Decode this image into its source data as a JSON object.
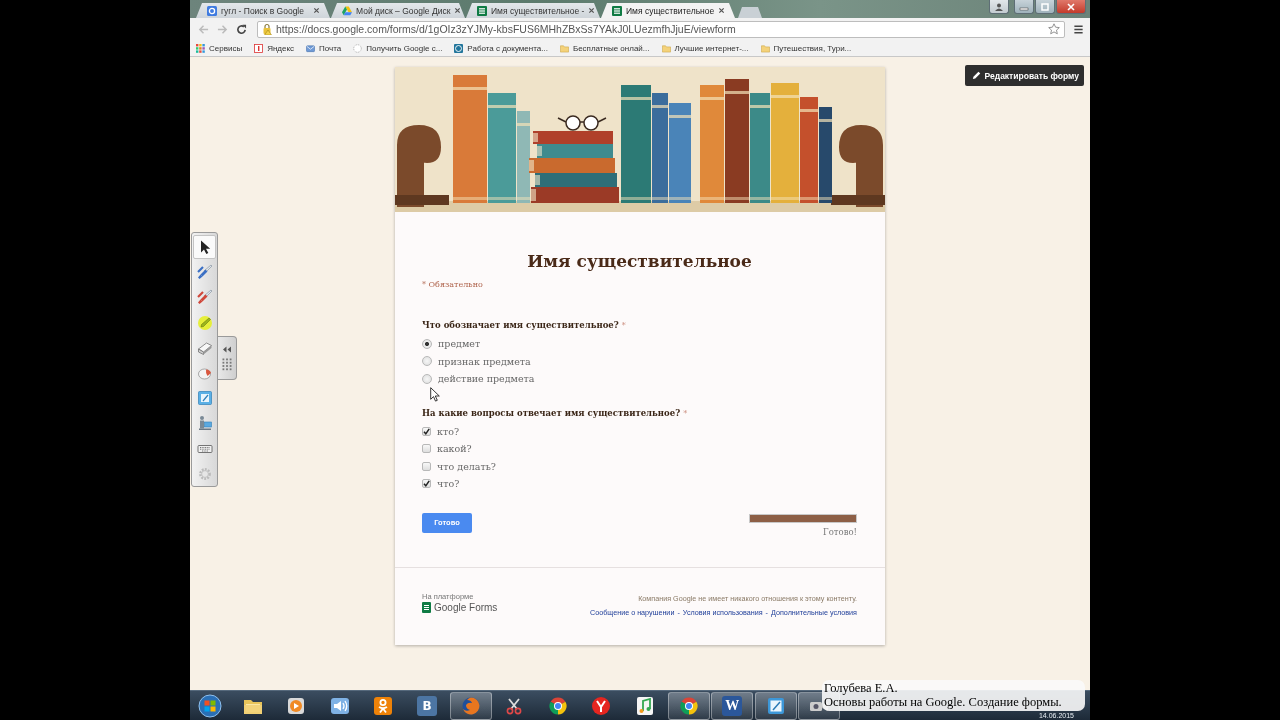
{
  "browser": {
    "tabs": [
      {
        "title": "гугл - Поиск в Google",
        "selected": false
      },
      {
        "title": "Мой диск – Google Диск",
        "selected": false
      },
      {
        "title": "Имя существительное -",
        "selected": false
      },
      {
        "title": "Имя существительное",
        "selected": true
      }
    ],
    "url": "https://docs.google.com/forms/d/1gOIz3zYJMy-kbsFUS6MHhZBxSs7YAkJ0LUezmfhJjuE/viewform",
    "bookmarks": [
      {
        "label": "Сервисы"
      },
      {
        "label": "Яндекс"
      },
      {
        "label": "Почта"
      },
      {
        "label": "Получить Google с..."
      },
      {
        "label": "Работа с документа..."
      },
      {
        "label": "Бесплатные онлай..."
      },
      {
        "label": "Лучшие интернет-..."
      },
      {
        "label": "Путешествия, Тури..."
      }
    ]
  },
  "annotation_toolbar": {
    "tools": [
      {
        "kind": "pointer",
        "selected": true
      },
      {
        "kind": "pen",
        "selected": false
      },
      {
        "kind": "pen",
        "selected": false
      },
      {
        "kind": "highlighter",
        "selected": false
      },
      {
        "kind": "eraser",
        "selected": false
      },
      {
        "kind": "ball",
        "selected": false
      },
      {
        "kind": "note",
        "selected": false
      },
      {
        "kind": "presenter",
        "selected": false
      },
      {
        "kind": "keyboard",
        "selected": false
      },
      {
        "kind": "settings",
        "selected": false
      }
    ]
  },
  "edit_button": {
    "label": "Редактировать форму"
  },
  "form": {
    "title": "Имя существительное",
    "required_note": "* Обязательно",
    "questions": [
      {
        "kind": "radio",
        "text": "Что обозначает имя существительное?",
        "required_mark": "*",
        "options": [
          {
            "label": "предмет",
            "selected": true
          },
          {
            "label": "признак предмета",
            "selected": false
          },
          {
            "label": "действие предмета",
            "selected": false
          }
        ]
      },
      {
        "kind": "checkbox",
        "text": "На какие вопросы отвечает имя существительное?",
        "required_mark": "*",
        "options": [
          {
            "label": "кто?",
            "checked": true
          },
          {
            "label": "какой?",
            "checked": false
          },
          {
            "label": "что делать?",
            "checked": false
          },
          {
            "label": "что?",
            "checked": true
          }
        ]
      }
    ],
    "submit": "Готово",
    "progress": {
      "level": 1,
      "label": "Готово!"
    },
    "footer": {
      "platform_label": "На платформе",
      "logo_text": "Google Forms",
      "disclaimer": "Компания Google не имеет никакого отношения к этому контенту.",
      "links": [
        {
          "label": "Сообщение о нарушении",
          "separator": "-"
        },
        {
          "label": "Условия использования",
          "separator": "-"
        },
        {
          "label": "Дополнительные условия"
        }
      ]
    }
  },
  "taskbar": {
    "items": [
      {
        "kind": "start",
        "running": false
      },
      {
        "kind": "folder",
        "running": false
      },
      {
        "kind": "player",
        "running": false
      },
      {
        "kind": "speaker",
        "running": false
      },
      {
        "kind": "figure",
        "running": false
      },
      {
        "kind": "vk",
        "glyph": "В",
        "running": false
      },
      {
        "kind": "globe",
        "running": true
      },
      {
        "kind": "scissors",
        "running": false
      },
      {
        "kind": "ring",
        "running": false
      },
      {
        "kind": "logo",
        "running": false
      },
      {
        "kind": "music",
        "running": false
      },
      {
        "kind": "ring",
        "running": true
      },
      {
        "kind": "word",
        "glyph": "W",
        "running": true
      },
      {
        "kind": "note",
        "running": true
      },
      {
        "kind": "camera",
        "running": true
      }
    ],
    "date": "14.06.2015"
  },
  "caption": {
    "author": "Голубева Е.А.",
    "title": "Основы работы на Google. Создание формы."
  }
}
